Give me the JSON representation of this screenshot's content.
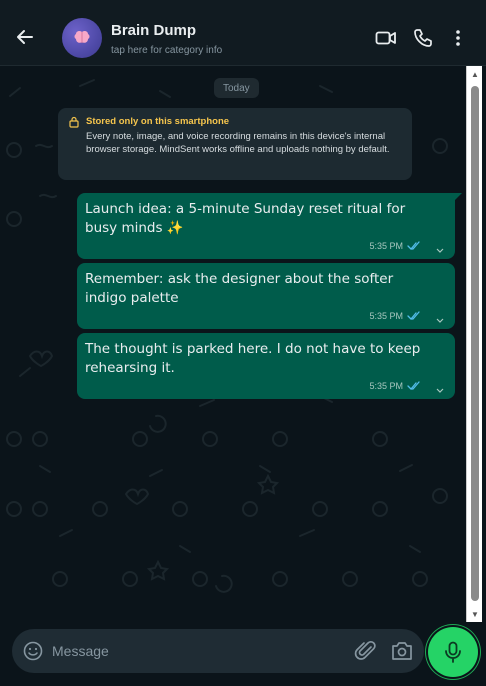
{
  "header": {
    "title": "Brain Dump",
    "subtitle": "tap here for category info",
    "icons": [
      "back-arrow-icon",
      "brain-avatar",
      "video-call-icon",
      "phone-icon",
      "more-vertical-icon"
    ]
  },
  "chat": {
    "date_chip": "Today",
    "notice": {
      "title": "Stored only on this smartphone",
      "body": "Every note, image, and voice recording remains in this device's internal browser storage. MindSent works offline and uploads nothing by default."
    },
    "messages": [
      {
        "text": "Launch idea: a 5-minute Sunday reset ritual for busy minds ✨",
        "time": "5:35 PM",
        "status": "read"
      },
      {
        "text": "Remember: ask the designer about the softer indigo palette",
        "time": "5:35 PM",
        "status": "read"
      },
      {
        "text": "The thought is parked here. I do not have to keep rehearsing it.",
        "time": "5:35 PM",
        "status": "read"
      }
    ]
  },
  "composer": {
    "placeholder": "Message",
    "icons": [
      "emoji-icon",
      "attach-icon",
      "camera-icon",
      "mic-icon"
    ]
  },
  "colors": {
    "header_bg": "#111b21",
    "chat_bg": "#0b141a",
    "bubble_out": "#005c4b",
    "notice_title": "#f5c54d",
    "mic_button": "#25d366",
    "read_ticks": "#53bdeb"
  }
}
